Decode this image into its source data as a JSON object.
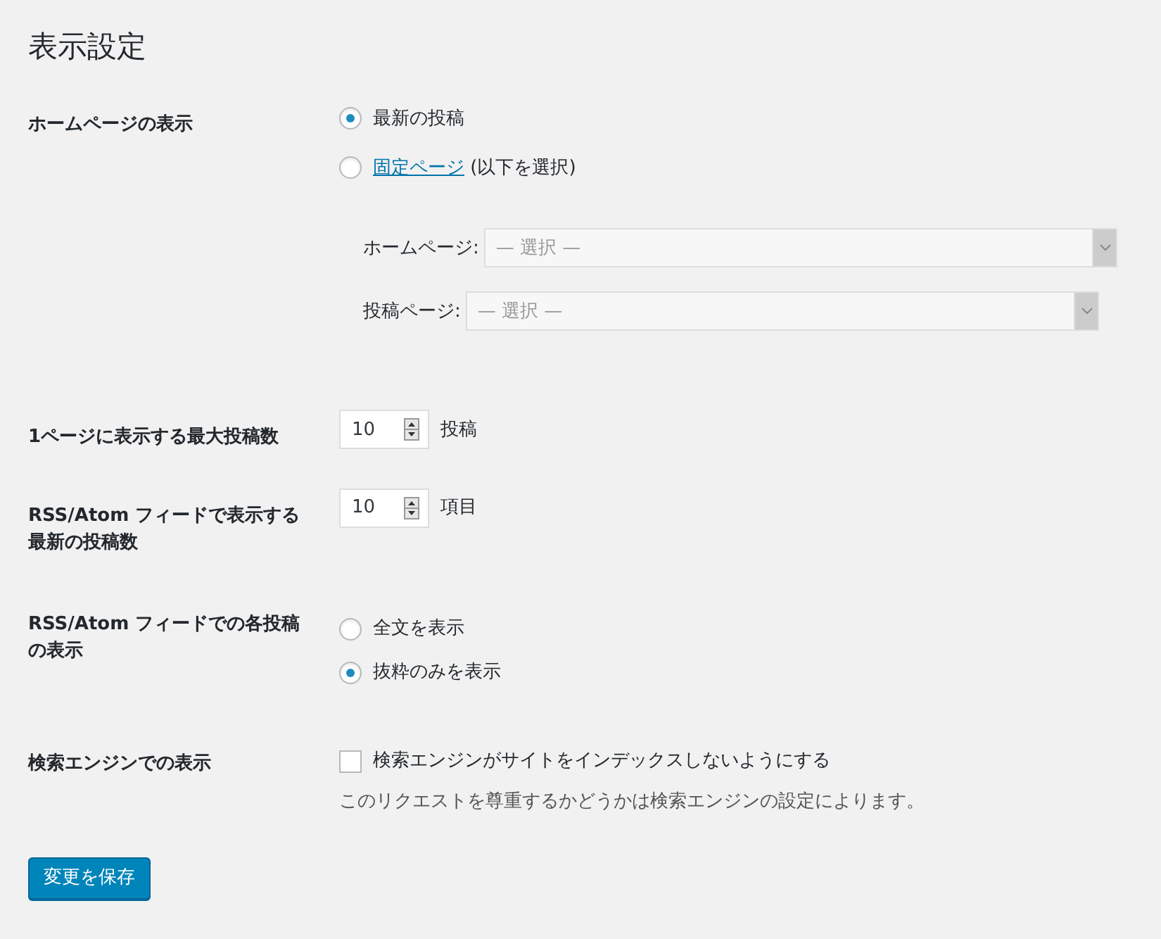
{
  "title": "表示設定",
  "homepage_display": {
    "label": "ホームページの表示",
    "options": [
      {
        "kind": "text",
        "label": "最新の投稿",
        "selected": true
      },
      {
        "kind": "link",
        "label": "固定ページ",
        "suffix": "(以下を選択)",
        "selected": false
      }
    ],
    "selects": [
      {
        "label": "ホームページ:",
        "placeholder": "— 選択 —",
        "disabled": true
      },
      {
        "label": "投稿ページ:",
        "placeholder": "— 選択 —",
        "disabled": true
      }
    ]
  },
  "posts_per_page": {
    "label": "1ページに表示する最大投稿数",
    "value": "10",
    "unit": "投稿"
  },
  "feed_items": {
    "label": "RSS/Atom フィードで表示する最新の投稿数",
    "value": "10",
    "unit": "項目"
  },
  "feed_display": {
    "label": "RSS/Atom フィードでの各投稿の表示",
    "options": [
      {
        "label": "全文を表示",
        "selected": false
      },
      {
        "label": "抜粋のみを表示",
        "selected": true
      }
    ]
  },
  "search_engine": {
    "label": "検索エンジンでの表示",
    "checkbox": {
      "label": "検索エンジンがサイトをインデックスしないようにする",
      "checked": false
    },
    "description": "このリクエストを尊重するかどうかは検索エンジンの設定によります。"
  },
  "save_button": "変更を保存"
}
